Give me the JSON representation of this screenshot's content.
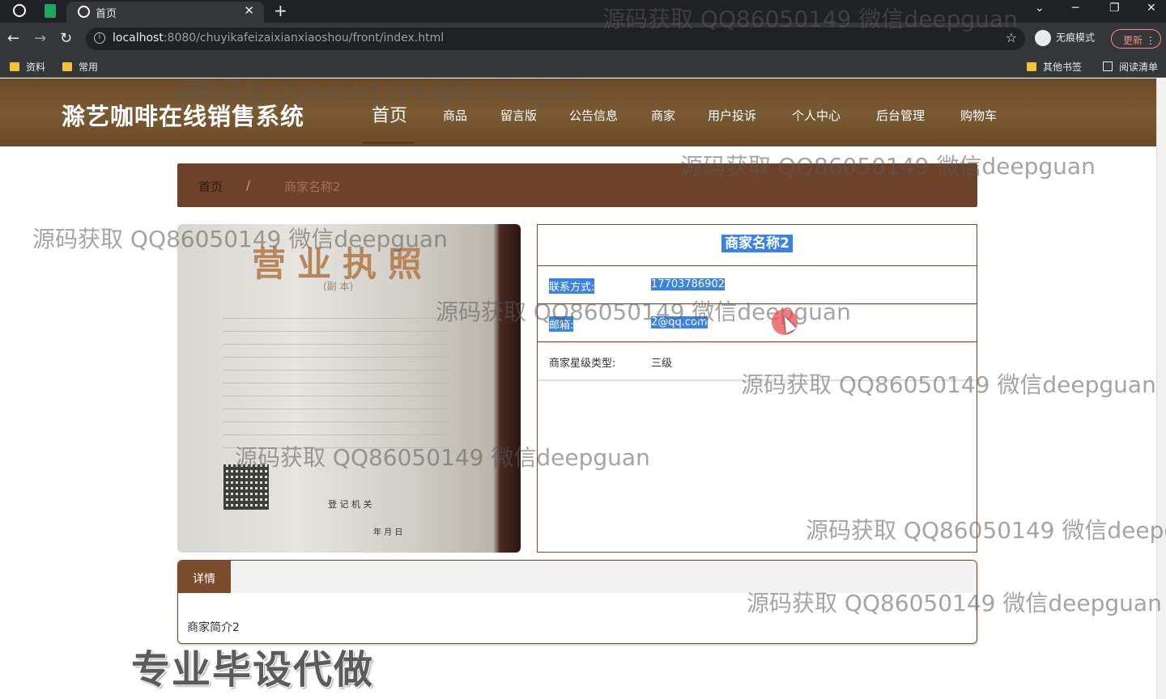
{
  "browser": {
    "tab_title": "首页",
    "url_host": "localhost",
    "url_rest": ":8080/chuyikafeizaixianxiaoshou/front/index.html",
    "incognito_label": "无痕模式",
    "update_label": "更新",
    "bookmarks": [
      "资料",
      "常用"
    ],
    "other_bookmarks": "其他书签",
    "reading_list": "阅读清单"
  },
  "site": {
    "title": "滁艺咖啡在线销售系统",
    "nav": [
      "首页",
      "商品",
      "留言版",
      "公告信息",
      "商家",
      "用户投诉",
      "个人中心",
      "后台管理",
      "购物车"
    ]
  },
  "breadcrumb": {
    "home": "首页",
    "separator": "/",
    "current": "商家名称2"
  },
  "license_image": {
    "heading": "营业执照",
    "subtitle": "(副 本)",
    "registration_authority": "登 记 机 关",
    "date": "年 月 日"
  },
  "merchant": {
    "name": "商家名称2",
    "fields": [
      {
        "label": "联系方式:",
        "value": "17703786902"
      },
      {
        "label": "邮箱:",
        "value": "2@qq.com"
      },
      {
        "label": "商家星级类型:",
        "value": "三级"
      }
    ]
  },
  "details": {
    "tab_label": "详情",
    "body": "商家简介2"
  },
  "overlays": {
    "watermark": "源码获取 QQ86050149 微信deepguan",
    "banner": "专业毕设代做"
  },
  "colors": {
    "header_brown": "#6b4a25",
    "breadcrumb_brown": "#6e4129",
    "selection_blue": "#3b82e6"
  }
}
